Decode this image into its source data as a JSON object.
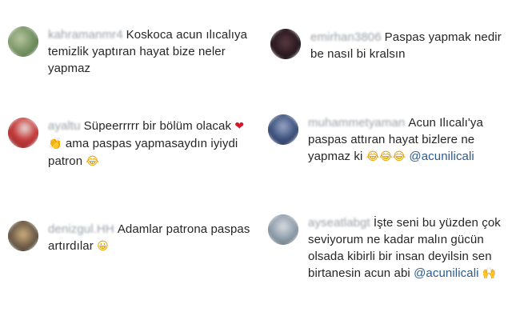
{
  "comments": [
    {
      "user": "kahramanmr4",
      "text_before": "Koskoca acun ılıcalıya temizlik yaptıran hayat bize neler yapmaz",
      "mention": "",
      "emojis": ""
    },
    {
      "user": "emirhan3806",
      "text_before": "Paspas yapmak nedir be nasıl bi kralsın",
      "mention": "",
      "emojis": ""
    },
    {
      "user": "ayaltu",
      "text_before": "Süpeerrrrr bir bölüm olacak",
      "emojis_mid": "❤👏",
      "text_after": "ama paspas yapmasaydın iyiydi patron",
      "emojis": "😂"
    },
    {
      "user": "muhammetyaman",
      "text_before": "Acun Ilıcalı'ya paspas attıran hayat bizlere ne yapmaz ki",
      "emojis": "😂😂😂",
      "mention": "@acunilicali"
    },
    {
      "user": "denizgul.HH",
      "text_before": "Adamlar patrona paspas artırdılar",
      "emojis": "😀"
    },
    {
      "user": "ayseatlabgt",
      "text_before": "İşte seni bu yüzden çok seviyorum ne kadar malın gücün olsada kibirli bir insan deyilsin sen birtanesin acun abi",
      "mention": "@acunilicali",
      "emojis": "🙌"
    }
  ],
  "avatar_colors": [
    "#7a9a6b",
    "#2a1820",
    "#c63b3b",
    "#3b4f7a",
    "#5b6b7b",
    "#8c9aa8"
  ]
}
